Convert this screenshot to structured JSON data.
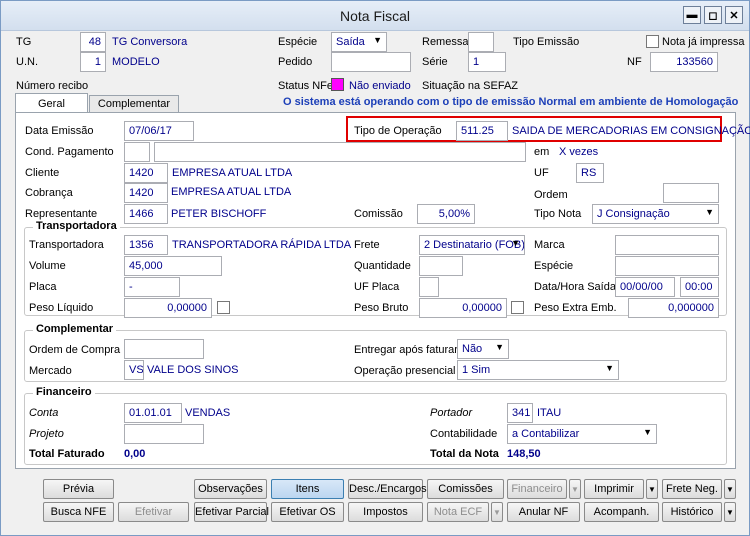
{
  "window": {
    "title": "Nota Fiscal"
  },
  "header": {
    "tg_label": "TG",
    "tg_value": "48",
    "tg_desc": "TG Conversora",
    "un_label": "U.N.",
    "un_value": "1",
    "un_desc": "MODELO",
    "recibo_label": "Número recibo",
    "especie_label": "Espécie",
    "especie_value": "Saída",
    "pedido_label": "Pedido",
    "status_label": "Status NFe",
    "status_value": "Não enviado",
    "remessa_label": "Remessa",
    "serie_label": "Série",
    "serie_value": "1",
    "sefaz_label": "Situação na SEFAZ",
    "tipo_emissao_label": "Tipo Emissão",
    "impressa_label": "Nota já impressa",
    "nf_label": "NF",
    "nf_value": "133560",
    "status_color": "#ff00ff"
  },
  "tabs": [
    {
      "label": "Geral"
    },
    {
      "label": "Complementar"
    }
  ],
  "system_message": "O sistema está operando com o tipo de emissão Normal em ambiente de Homologação",
  "geral": {
    "data_emissao_label": "Data Emissão",
    "data_emissao_value": "07/06/17",
    "tipo_operacao_label": "Tipo de Operação",
    "tipo_operacao_code": "511.25",
    "tipo_operacao_desc": "SAIDA DE MERCADORIAS EM CONSIGNAÇÃO",
    "cond_pagamento_label": "Cond. Pagamento",
    "em_label": "em",
    "vezes_label": "X vezes",
    "cliente_label": "Cliente",
    "cliente_code": "1420",
    "cliente_name": "EMPRESA ATUAL LTDA",
    "uf_label": "UF",
    "uf_value": "RS",
    "cobranca_label": "Cobrança",
    "cobranca_code": "1420",
    "cobranca_name": "EMPRESA ATUAL LTDA",
    "ordem_label": "Ordem",
    "representante_label": "Representante",
    "representante_code": "1466",
    "representante_name": "PETER BISCHOFF",
    "comissao_label": "Comissão",
    "comissao_value": "5,00%",
    "tipo_nota_label": "Tipo Nota",
    "tipo_nota_value": "J Consignação"
  },
  "transportadora": {
    "title": "Transportadora",
    "transportadora_label": "Transportadora",
    "transportadora_code": "1356",
    "transportadora_name": "TRANSPORTADORA RÁPIDA LTDA",
    "frete_label": "Frete",
    "frete_value": "2 Destinatario (FOB)",
    "marca_label": "Marca",
    "volume_label": "Volume",
    "volume_value": "45,000",
    "quantidade_label": "Quantidade",
    "especie_label": "Espécie",
    "placa_label": "Placa",
    "placa_value": "-",
    "uf_placa_label": "UF Placa",
    "data_hora_label": "Data/Hora Saída",
    "data_value": "00/00/00",
    "hora_value": "00:00",
    "peso_liquido_label": "Peso Líquido",
    "peso_liquido_value": "0,00000",
    "peso_bruto_label": "Peso Bruto",
    "peso_bruto_value": "0,00000",
    "peso_extra_label": "Peso Extra Emb.",
    "peso_extra_value": "0,000000"
  },
  "complementar": {
    "title": "Complementar",
    "ordem_compra_label": "Ordem de Compra",
    "entregar_label": "Entregar após faturar",
    "entregar_value": "Não",
    "mercado_label": "Mercado",
    "mercado_code": "VS",
    "mercado_name": "VALE DOS SINOS",
    "operacao_label": "Operação presencial",
    "operacao_value": "1 Sim"
  },
  "financeiro": {
    "title": "Financeiro",
    "conta_label": "Conta",
    "conta_code": "01.01.01",
    "conta_name": "VENDAS",
    "portador_label": "Portador",
    "portador_code": "341",
    "portador_name": "ITAU",
    "projeto_label": "Projeto",
    "contabilidade_label": "Contabilidade",
    "contabilidade_value": "a Contabilizar",
    "total_faturado_label": "Total Faturado",
    "total_faturado_value": "0,00",
    "total_nota_label": "Total da Nota",
    "total_nota_value": "148,50"
  },
  "buttons": {
    "previa": "Prévia",
    "observacoes": "Observações",
    "itens": "Itens",
    "desc_encargos": "Desc./Encargos",
    "comissoes": "Comissões",
    "financeiro": "Financeiro",
    "imprimir": "Imprimir",
    "frete_neg": "Frete Neg.",
    "busca_nfe": "Busca NFE",
    "efetivar": "Efetivar",
    "efetivar_parcial": "Efetivar Parcial",
    "efetivar_os": "Efetivar OS",
    "impostos": "Impostos",
    "nota_ecf": "Nota ECF",
    "anular_nf": "Anular NF",
    "acompanh": "Acompanh.",
    "historico": "Histórico"
  }
}
